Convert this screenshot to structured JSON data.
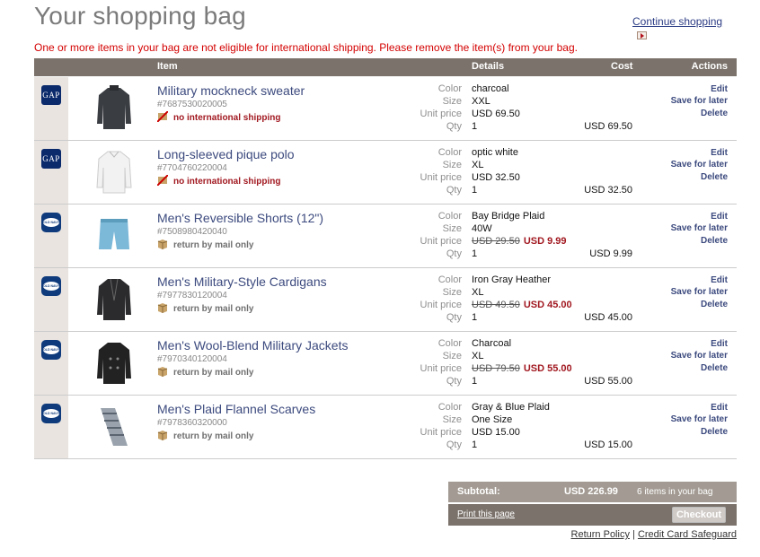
{
  "page": {
    "title": "Your shopping bag",
    "continue_label": "Continue shopping",
    "warning": "One or more items in your bag are not eligible for international shipping. Please remove the item(s) from your bag."
  },
  "table_header": {
    "item": "Item",
    "details": "Details",
    "cost": "Cost",
    "actions": "Actions"
  },
  "detail_labels": {
    "color": "Color",
    "size": "Size",
    "unit_price": "Unit price",
    "qty": "Qty"
  },
  "action_labels": {
    "edit": "Edit",
    "save": "Save for later",
    "delete": "Delete"
  },
  "items": [
    {
      "brand": "GAP",
      "name": "Military mockneck sweater",
      "sku": "#7687530020005",
      "note": "no international shipping",
      "color": "charcoal",
      "size": "XXL",
      "unit_price": "USD 69.50",
      "orig_price": "",
      "sale_price": "",
      "qty": "1",
      "cost": "USD 69.50"
    },
    {
      "brand": "GAP",
      "name": "Long-sleeved pique polo",
      "sku": "#7704760220004",
      "note": "no international shipping",
      "color": "optic white",
      "size": "XL",
      "unit_price": "USD 32.50",
      "orig_price": "",
      "sale_price": "",
      "qty": "1",
      "cost": "USD 32.50"
    },
    {
      "brand": "OLD NAVY",
      "name": "Men's Reversible Shorts (12\")",
      "sku": "#7508980420040",
      "note": "return by mail only",
      "color": "Bay Bridge Plaid",
      "size": "40W",
      "unit_price": "",
      "orig_price": "USD 29.50",
      "sale_price": "USD 9.99",
      "qty": "1",
      "cost": "USD 9.99"
    },
    {
      "brand": "OLD NAVY",
      "name": "Men's Military-Style Cardigans",
      "sku": "#7977830120004",
      "note": "return by mail only",
      "color": "Iron Gray Heather",
      "size": "XL",
      "unit_price": "",
      "orig_price": "USD 49.50",
      "sale_price": "USD 45.00",
      "qty": "1",
      "cost": "USD 45.00"
    },
    {
      "brand": "OLD NAVY",
      "name": "Men's Wool-Blend Military Jackets",
      "sku": "#7970340120004",
      "note": "return by mail only",
      "color": "Charcoal",
      "size": "XL",
      "unit_price": "",
      "orig_price": "USD 79.50",
      "sale_price": "USD 55.00",
      "qty": "1",
      "cost": "USD 55.00"
    },
    {
      "brand": "OLD NAVY",
      "name": "Men's Plaid Flannel Scarves",
      "sku": "#7978360320000",
      "note": "return by mail only",
      "color": "Gray & Blue Plaid",
      "size": "One Size",
      "unit_price": "USD 15.00",
      "orig_price": "",
      "sale_price": "",
      "qty": "1",
      "cost": "USD 15.00"
    }
  ],
  "summary": {
    "subtotal_label": "Subtotal:",
    "subtotal_value": "USD 226.99",
    "item_count": "6 items in your bag",
    "print_label": "Print this page",
    "checkout_label": "Checkout"
  },
  "footer": {
    "return_policy": "Return Policy",
    "separator": "|",
    "safeguard": "Credit Card Safeguard"
  }
}
